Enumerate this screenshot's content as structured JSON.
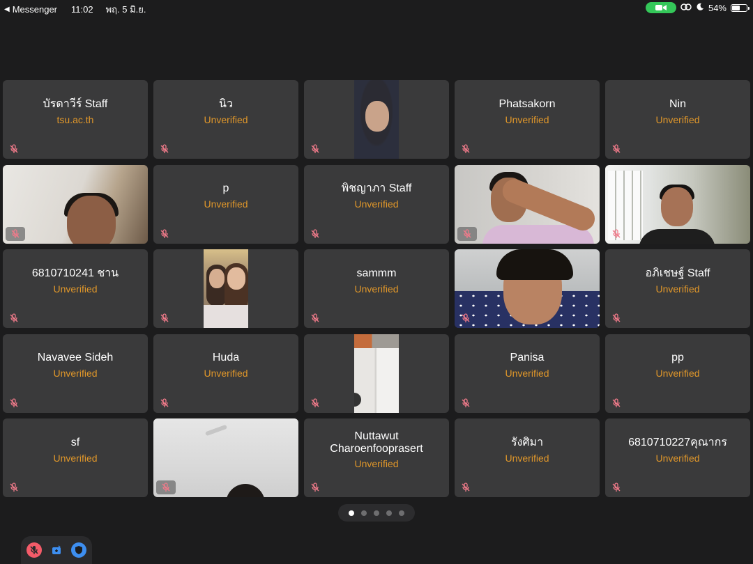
{
  "status_bar": {
    "back_app": "Messenger",
    "time": "11:02",
    "date": "พฤ. 5 มิ.ย.",
    "battery": "54%",
    "battery_level": 0.54
  },
  "participants": [
    {
      "name": "บัรดาวีร์ Staff",
      "status": "tsu.ac.th"
    },
    {
      "name": "นิว",
      "status": "Unverified"
    },
    {
      "video": "hijab-video"
    },
    {
      "name": "Phatsakorn",
      "status": "Unverified"
    },
    {
      "name": "Nin",
      "status": "Unverified"
    },
    {
      "video": "room-video"
    },
    {
      "name": "p",
      "status": "Unverified"
    },
    {
      "name": "พิชญาภา Staff",
      "status": "Unverified"
    },
    {
      "video": "boy-hand-video"
    },
    {
      "video": "boy-window-video"
    },
    {
      "name": "6810710241 ชาน",
      "status": "Unverified"
    },
    {
      "video": "girls-video"
    },
    {
      "name": "sammm",
      "status": "Unverified"
    },
    {
      "video": "boy-closeup-video"
    },
    {
      "name": "อภิเชษฐ์ Staff",
      "status": "Unverified"
    },
    {
      "name": "Navavee Sideh",
      "status": "Unverified"
    },
    {
      "name": "Huda",
      "status": "Unverified"
    },
    {
      "video": "door-video"
    },
    {
      "name": "Panisa",
      "status": "Unverified"
    },
    {
      "name": "pp",
      "status": "Unverified"
    },
    {
      "name": "sf",
      "status": "Unverified"
    },
    {
      "video": "ceiling-video"
    },
    {
      "name": "Nuttawut Charoenfooprasert",
      "status": "Unverified"
    },
    {
      "name": "รังศิมา",
      "status": "Unverified"
    },
    {
      "name": "6810710227คุณากร",
      "status": "Unverified"
    }
  ],
  "pagination": {
    "total_pages": 5,
    "current_page": 1
  },
  "controls": {
    "mic_icon": "mic-muted-icon",
    "share_icon": "share-screen-icon",
    "shield_icon": "shield-icon"
  },
  "colors": {
    "background": "#1c1c1d",
    "tile": "#3a3a3b",
    "unverified": "#e0972a",
    "mute": "#f07a8a",
    "camera_pill": "#34c759",
    "mic_button": "#f45b69",
    "shield_button": "#3d8ef0"
  }
}
